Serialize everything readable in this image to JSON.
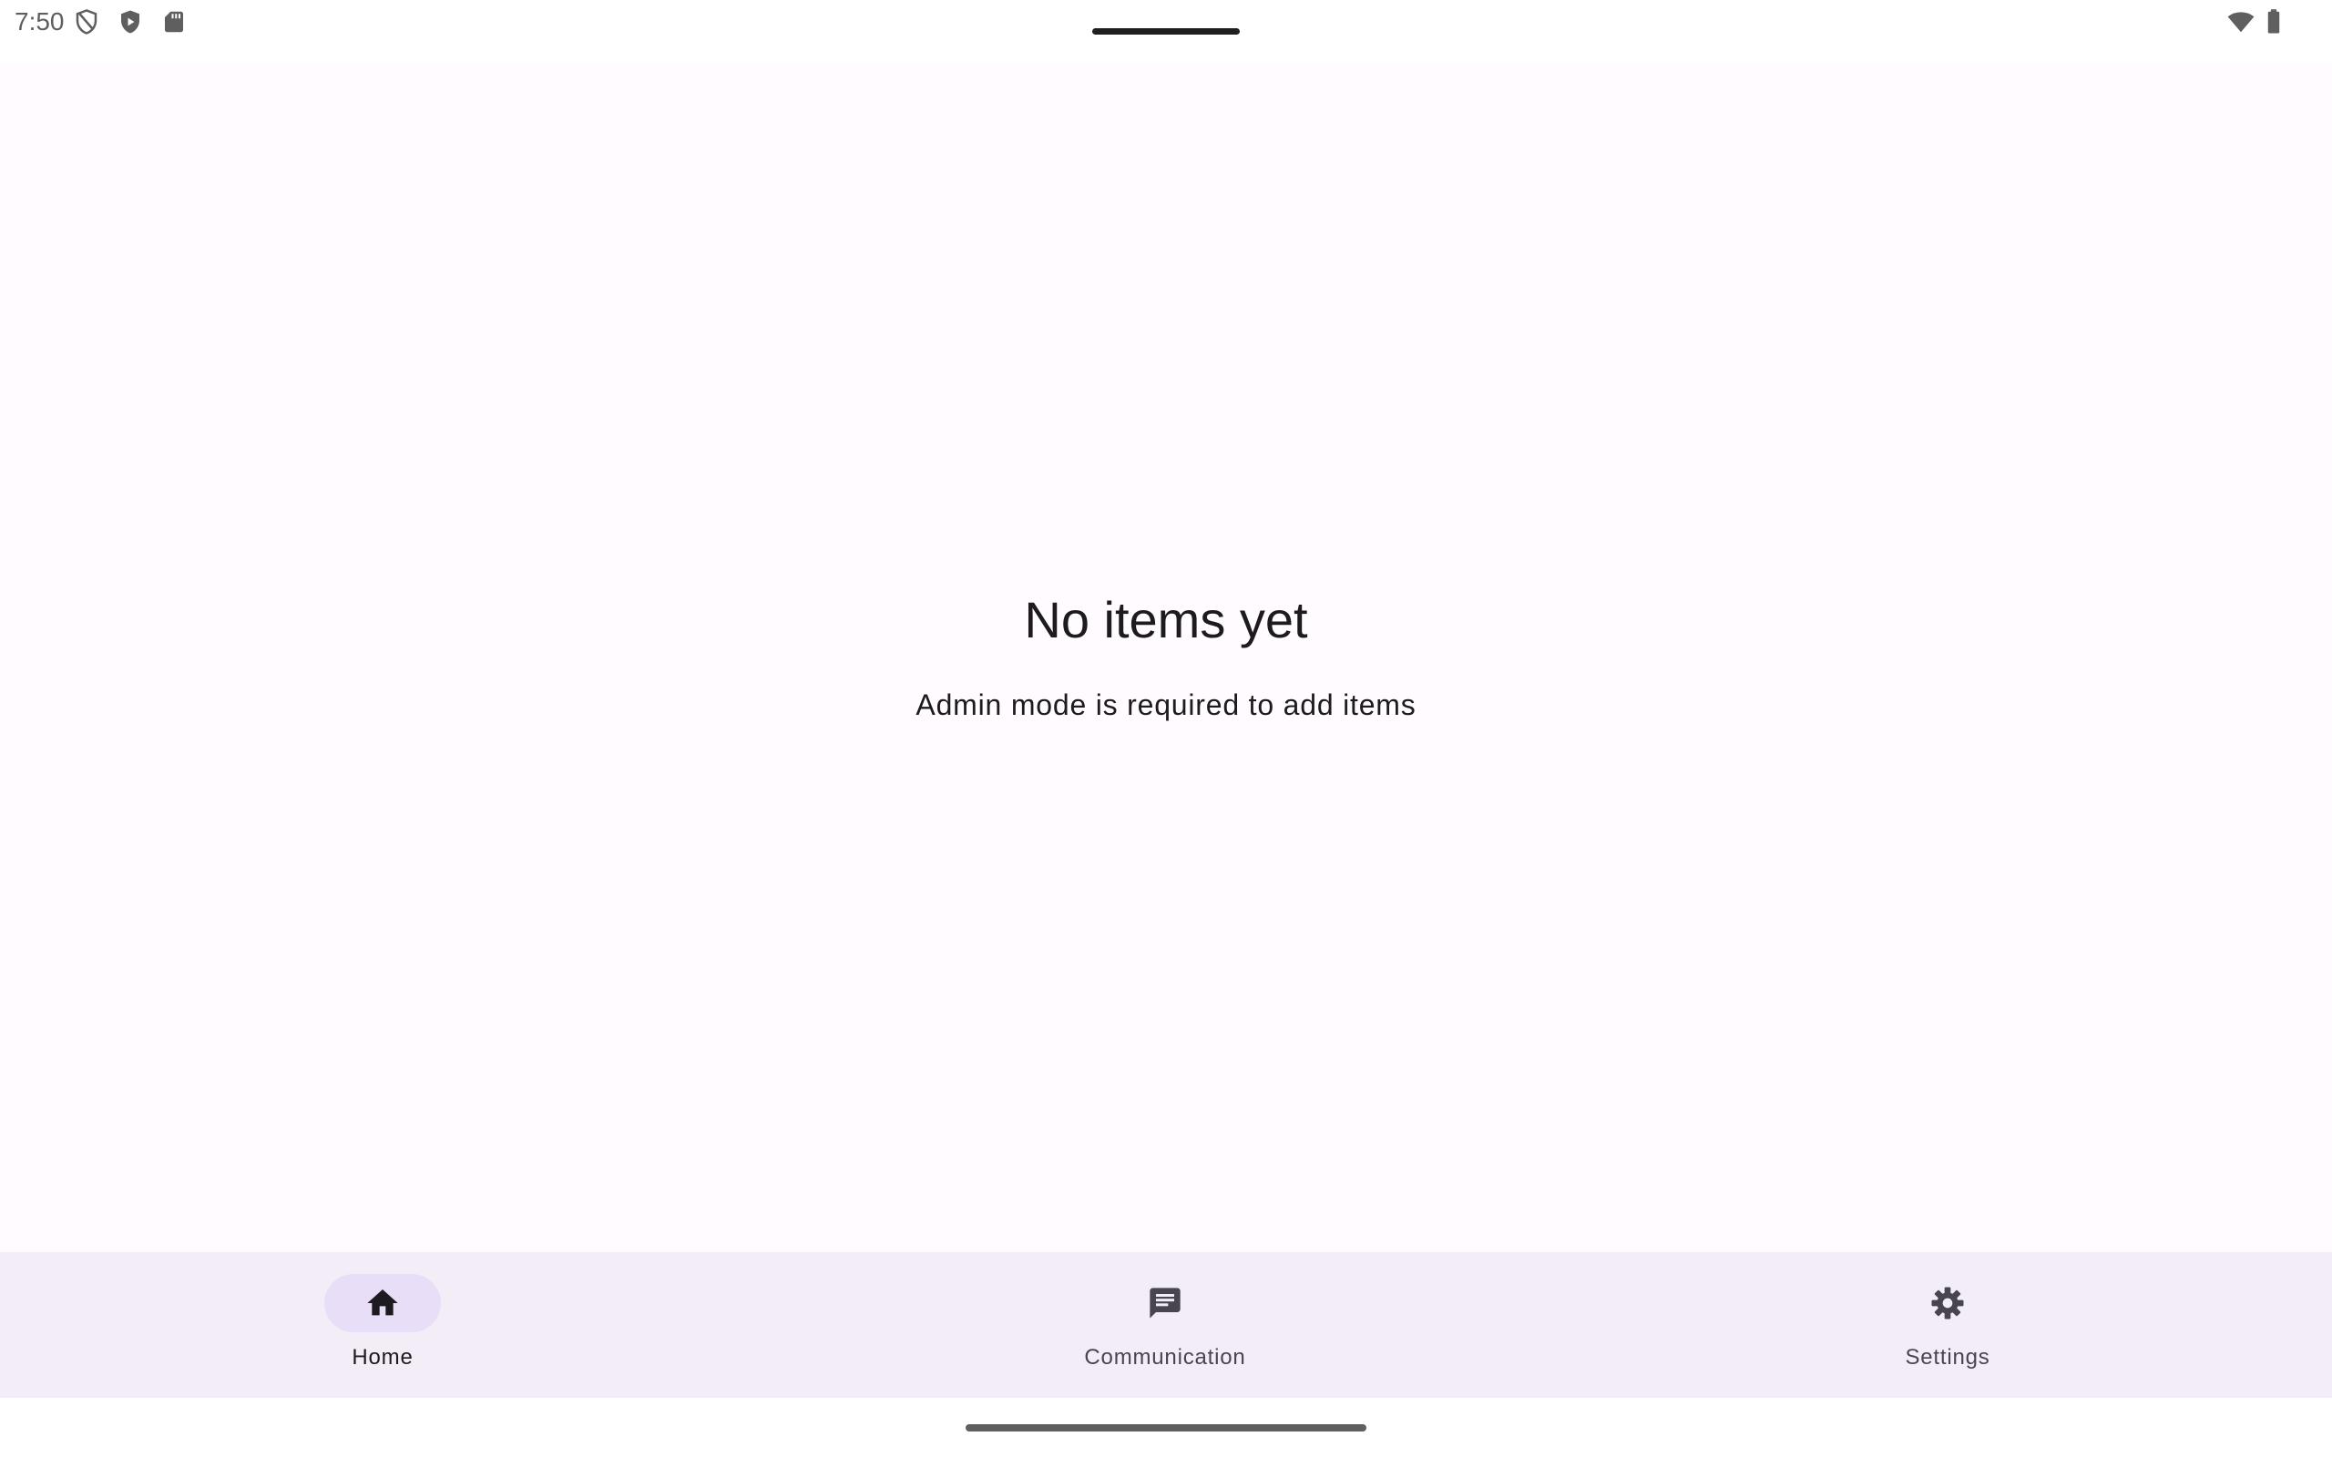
{
  "status_bar": {
    "time": "7:50",
    "left_icons": [
      "shield-off-icon",
      "play-protect-icon",
      "sd-card-icon"
    ],
    "right_icons": [
      "wifi-icon",
      "battery-icon"
    ]
  },
  "empty_state": {
    "title": "No items yet",
    "subtitle": "Admin mode is required to add items"
  },
  "bottom_nav": {
    "items": [
      {
        "label": "Home",
        "icon": "home-icon",
        "active": true
      },
      {
        "label": "Communication",
        "icon": "message-icon",
        "active": false
      },
      {
        "label": "Settings",
        "icon": "gear-icon",
        "active": false
      }
    ]
  },
  "colors": {
    "background": "#fffbfe",
    "nav_background": "#f3edf7",
    "active_indicator": "#e8def8",
    "text_primary": "#1d1b20",
    "text_secondary": "#49454f"
  }
}
